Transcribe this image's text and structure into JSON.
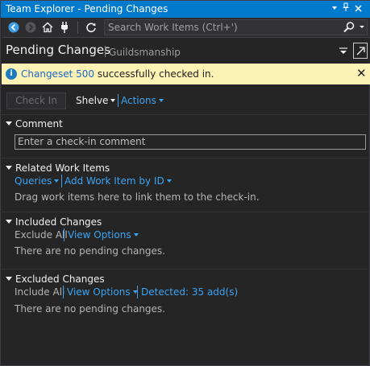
{
  "window": {
    "title": "Team Explorer - Pending Changes"
  },
  "toolbar": {
    "back_icon": "back-arrow-icon",
    "forward_icon": "forward-arrow-icon",
    "home_icon": "home-icon",
    "connect_icon": "plug-icon",
    "refresh_icon": "refresh-icon",
    "search_placeholder": "Search Work Items (Ctrl+')",
    "search_icon": "search-icon"
  },
  "header": {
    "page_title": "Pending Changes",
    "project": "Guildsmanship"
  },
  "infobar": {
    "link_text": "Changeset 500",
    "message": " successfully checked in.",
    "close_glyph": "✕",
    "info_glyph": "i"
  },
  "actions": {
    "check_in": "Check In",
    "shelve": "Shelve",
    "actions": "Actions"
  },
  "comment": {
    "heading": "Comment",
    "placeholder": "Enter a check-in comment"
  },
  "related_work_items": {
    "heading": "Related Work Items",
    "queries": "Queries",
    "add_by_id": "Add Work Item by ID",
    "hint": "Drag work items here to link them to the check-in."
  },
  "included_changes": {
    "heading": "Included Changes",
    "exclude_all": "Exclude All",
    "view_options": "View Options",
    "empty": "There are no pending changes."
  },
  "excluded_changes": {
    "heading": "Excluded Changes",
    "include_all": "Include All",
    "view_options": "View Options",
    "detected": "Detected: 35 add(s)",
    "empty": "There are no pending changes."
  },
  "colors": {
    "title_bar": "#007acc",
    "background": "#252526",
    "info_bar": "#fcf2b6",
    "link_blue": "#3ba4f4"
  }
}
